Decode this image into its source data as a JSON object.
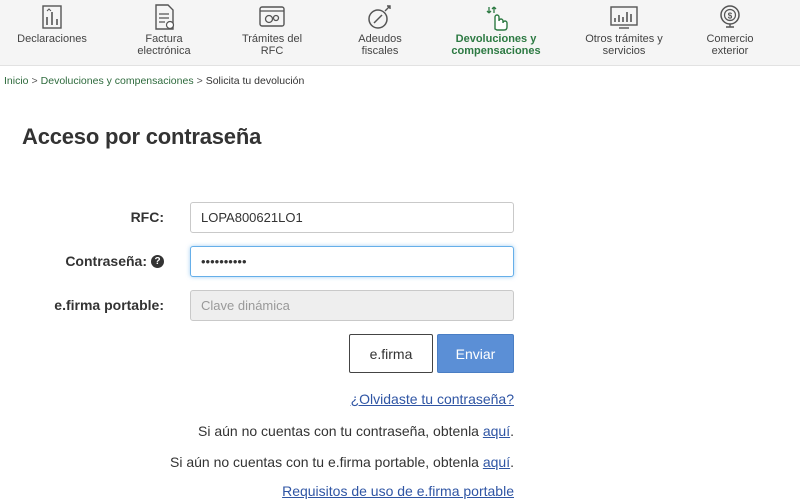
{
  "nav": {
    "items": [
      {
        "label": "Declaraciones",
        "icon": "declarations-icon"
      },
      {
        "label": "Factura electrónica",
        "icon": "invoice-icon"
      },
      {
        "label": "Trámites del RFC",
        "icon": "rfc-procedures-icon"
      },
      {
        "label": "Adeudos fiscales",
        "icon": "tax-debts-icon"
      },
      {
        "label": "Devoluciones y compensaciones",
        "icon": "refunds-icon",
        "active": true
      },
      {
        "label": "Otros trámites y servicios",
        "icon": "other-services-icon"
      },
      {
        "label": "Comercio exterior",
        "icon": "foreign-trade-icon"
      }
    ]
  },
  "breadcrumb": {
    "home": "Inicio",
    "section": "Devoluciones y compensaciones",
    "current": "Solicita tu devolución",
    "separator": ">"
  },
  "page": {
    "title": "Acceso por contraseña"
  },
  "form": {
    "rfc_label": "RFC:",
    "rfc_value": "LOPA800621LO1",
    "password_label": "Contraseña:",
    "password_value": "••••••••••",
    "efirma_label": "e.firma portable:",
    "efirma_placeholder": "Clave dinámica",
    "help_icon": "?"
  },
  "buttons": {
    "efirma": "e.firma",
    "submit": "Enviar"
  },
  "links": {
    "forgot": "¿Olvidaste tu contraseña?",
    "no_password_text": "Si aún no cuentas con tu contraseña, obtenla",
    "no_password_link": "aquí",
    "no_efirma_text": "Si aún no cuentas con tu e.firma portable, obtenla",
    "no_efirma_link": "aquí",
    "trailing_period": ".",
    "requirements": "Requisitos de uso de e.firma portable"
  },
  "colors": {
    "active_nav": "#2d7a43",
    "primary_button": "#5b8fd6",
    "link": "#2f55a4"
  }
}
